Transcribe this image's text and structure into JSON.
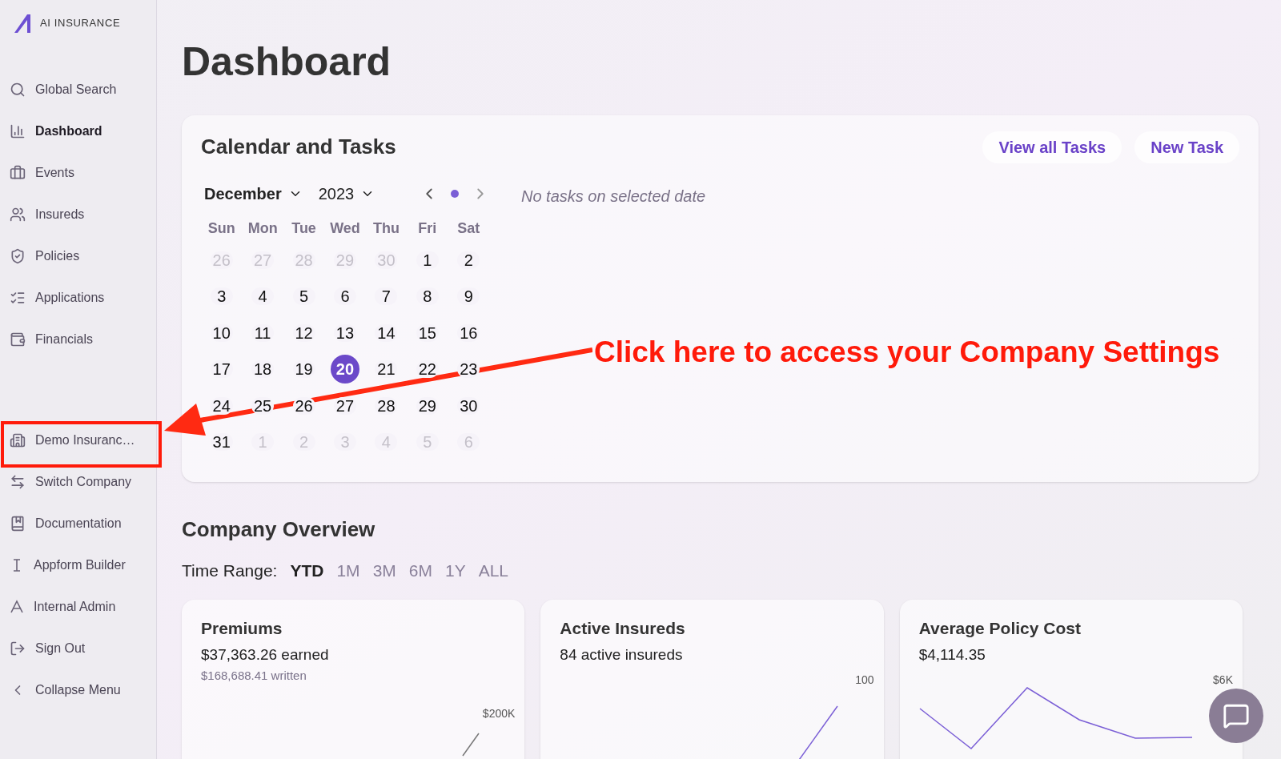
{
  "brand": {
    "name": "AI INSURANCE"
  },
  "sidebar": {
    "items": [
      {
        "label": "Global Search",
        "selected": false
      },
      {
        "label": "Dashboard",
        "selected": true
      },
      {
        "label": "Events",
        "selected": false
      },
      {
        "label": "Insureds",
        "selected": false
      },
      {
        "label": "Policies",
        "selected": false
      },
      {
        "label": "Applications",
        "selected": false
      },
      {
        "label": "Financials",
        "selected": false
      }
    ],
    "bottom_items": [
      {
        "label": "Demo Insuranc…",
        "selected": false
      },
      {
        "label": "Switch Company",
        "selected": false
      },
      {
        "label": "Documentation",
        "selected": false
      },
      {
        "label": "Appform Builder",
        "selected": false
      },
      {
        "label": "Internal Admin",
        "selected": false
      },
      {
        "label": "Sign Out",
        "selected": false
      },
      {
        "label": "Collapse Menu",
        "selected": false
      }
    ]
  },
  "page_title": "Dashboard",
  "calendar_card": {
    "title": "Calendar and Tasks",
    "buttons": [
      "View all Tasks",
      "New Task"
    ],
    "month": "December",
    "year": "2023",
    "empty_message": "No tasks on selected date",
    "weekdays": [
      "Sun",
      "Mon",
      "Tue",
      "Wed",
      "Thu",
      "Fri",
      "Sat"
    ],
    "days": [
      {
        "label": "26",
        "outside": true,
        "selected": false
      },
      {
        "label": "27",
        "outside": true,
        "selected": false
      },
      {
        "label": "28",
        "outside": true,
        "selected": false
      },
      {
        "label": "29",
        "outside": true,
        "selected": false
      },
      {
        "label": "30",
        "outside": true,
        "selected": false
      },
      {
        "label": "1",
        "outside": false,
        "selected": false
      },
      {
        "label": "2",
        "outside": false,
        "selected": false
      },
      {
        "label": "3",
        "outside": false,
        "selected": false
      },
      {
        "label": "4",
        "outside": false,
        "selected": false
      },
      {
        "label": "5",
        "outside": false,
        "selected": false
      },
      {
        "label": "6",
        "outside": false,
        "selected": false
      },
      {
        "label": "7",
        "outside": false,
        "selected": false
      },
      {
        "label": "8",
        "outside": false,
        "selected": false
      },
      {
        "label": "9",
        "outside": false,
        "selected": false
      },
      {
        "label": "10",
        "outside": false,
        "selected": false
      },
      {
        "label": "11",
        "outside": false,
        "selected": false
      },
      {
        "label": "12",
        "outside": false,
        "selected": false
      },
      {
        "label": "13",
        "outside": false,
        "selected": false
      },
      {
        "label": "14",
        "outside": false,
        "selected": false
      },
      {
        "label": "15",
        "outside": false,
        "selected": false
      },
      {
        "label": "16",
        "outside": false,
        "selected": false
      },
      {
        "label": "17",
        "outside": false,
        "selected": false
      },
      {
        "label": "18",
        "outside": false,
        "selected": false
      },
      {
        "label": "19",
        "outside": false,
        "selected": false
      },
      {
        "label": "20",
        "outside": false,
        "selected": true
      },
      {
        "label": "21",
        "outside": false,
        "selected": false
      },
      {
        "label": "22",
        "outside": false,
        "selected": false
      },
      {
        "label": "23",
        "outside": false,
        "selected": false
      },
      {
        "label": "24",
        "outside": false,
        "selected": false
      },
      {
        "label": "25",
        "outside": false,
        "selected": false
      },
      {
        "label": "26",
        "outside": false,
        "selected": false
      },
      {
        "label": "27",
        "outside": false,
        "selected": false
      },
      {
        "label": "28",
        "outside": false,
        "selected": false
      },
      {
        "label": "29",
        "outside": false,
        "selected": false
      },
      {
        "label": "30",
        "outside": false,
        "selected": false
      },
      {
        "label": "31",
        "outside": false,
        "selected": false
      },
      {
        "label": "1",
        "outside": true,
        "selected": false
      },
      {
        "label": "2",
        "outside": true,
        "selected": false
      },
      {
        "label": "3",
        "outside": true,
        "selected": false
      },
      {
        "label": "4",
        "outside": true,
        "selected": false
      },
      {
        "label": "5",
        "outside": true,
        "selected": false
      },
      {
        "label": "6",
        "outside": true,
        "selected": false
      }
    ]
  },
  "overview": {
    "title": "Company Overview",
    "range_label": "Time Range:",
    "ranges": [
      {
        "label": "YTD",
        "selected": true
      },
      {
        "label": "1M",
        "selected": false
      },
      {
        "label": "3M",
        "selected": false
      },
      {
        "label": "6M",
        "selected": false
      },
      {
        "label": "1Y",
        "selected": false
      },
      {
        "label": "ALL",
        "selected": false
      }
    ],
    "cards": [
      {
        "title": "Premiums",
        "value": "$37,363.26 earned",
        "sub": "$168,688.41 written",
        "ticks": [
          "$200K"
        ]
      },
      {
        "title": "Active Insureds",
        "value": "84 active insureds",
        "ticks": [
          "100"
        ]
      },
      {
        "title": "Average Policy Cost",
        "value": "$4,114.35",
        "ticks": [
          "$6K"
        ]
      }
    ]
  },
  "annotation": {
    "text": "Click here to access your Company Settings"
  }
}
